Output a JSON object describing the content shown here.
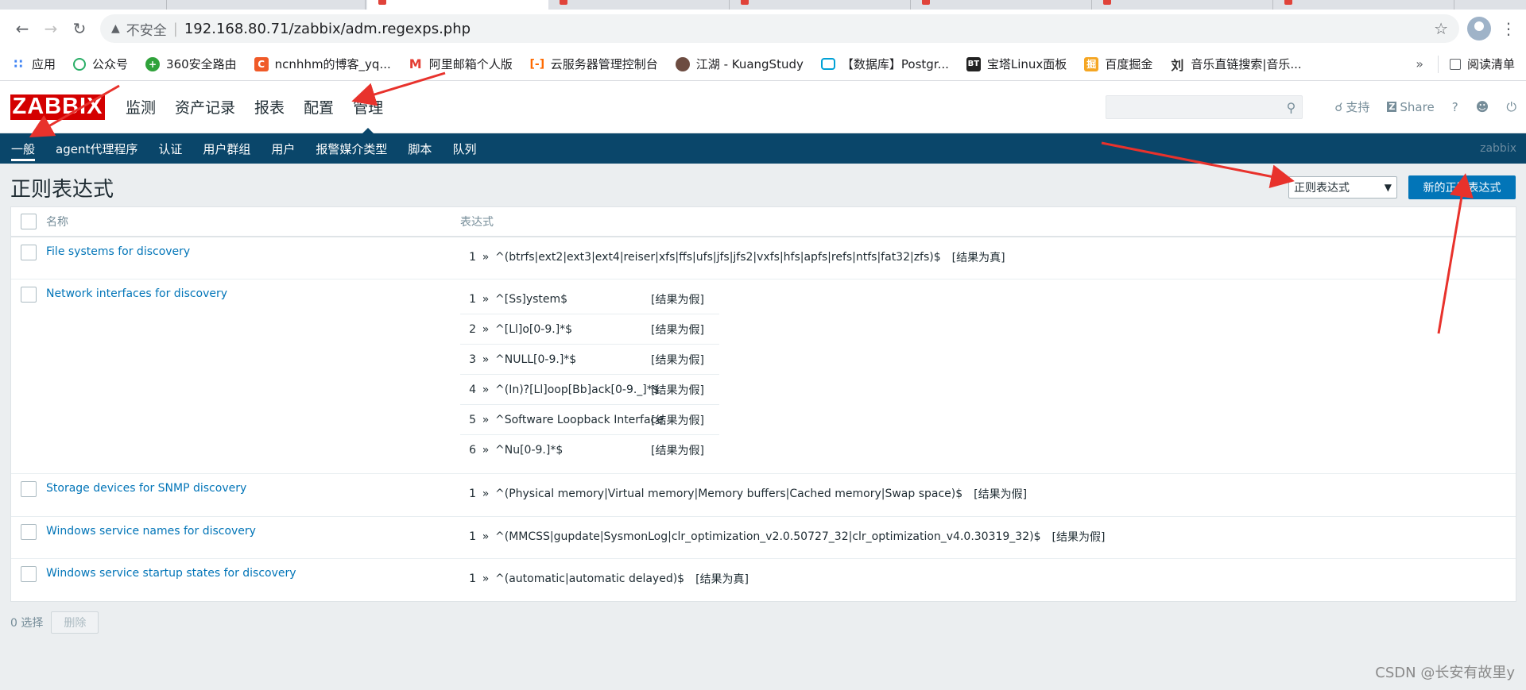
{
  "browser": {
    "insecure_label": "不安全",
    "url": "192.168.80.71/zabbix/adm.regexps.php"
  },
  "bookmarks": [
    {
      "label": "应用",
      "icon": "apps-grid-icon",
      "color": "#4285f4"
    },
    {
      "label": "公众号",
      "icon": "wechat-icon",
      "color": "#2aae67"
    },
    {
      "label": "360安全路由",
      "icon": "360-icon",
      "color": "#2fa23a"
    },
    {
      "label": "ncnhhm的博客_yq...",
      "icon": "csdn-icon",
      "color": "#f05a28"
    },
    {
      "label": "阿里邮箱个人版",
      "icon": "aliyun-mail-icon",
      "color": "#e33e33"
    },
    {
      "label": "云服务器管理控制台",
      "icon": "aliyun-icon",
      "color": "#ff6a00"
    },
    {
      "label": "江湖 - KuangStudy",
      "icon": "kuangstudy-icon",
      "color": "#6d4c41"
    },
    {
      "label": "【数据库】Postgr...",
      "icon": "bilibili-icon",
      "color": "#00a1d6"
    },
    {
      "label": "宝塔Linux面板",
      "icon": "bt-icon",
      "color": "#222222"
    },
    {
      "label": "百度掘金",
      "icon": "juejin-icon",
      "color": "#f5a623"
    },
    {
      "label": "音乐直链搜索|音乐...",
      "icon": "music-icon",
      "color": "#333333"
    }
  ],
  "bookmarks_more": "»",
  "reading_list": "阅读清单",
  "zabbix": {
    "logo": "ZABBIX",
    "topnav": [
      "监测",
      "资产记录",
      "报表",
      "配置",
      "管理"
    ],
    "support": "支持",
    "share": "Share",
    "help": "?",
    "subnav": [
      "一般",
      "agent代理程序",
      "认证",
      "用户群组",
      "用户",
      "报警媒介类型",
      "脚本",
      "队列"
    ],
    "user": "zabbix"
  },
  "page": {
    "title": "正则表达式",
    "select_value": "正则表达式",
    "new_button": "新的正则表达式",
    "col_name": "名称",
    "col_expression": "表达式",
    "rows": [
      {
        "name": "File systems for discovery",
        "expressions": [
          {
            "n": "1",
            "expr": "^(btrfs|ext2|ext3|ext4|reiser|xfs|ffs|ufs|jfs|jfs2|vxfs|hfs|apfs|refs|ntfs|fat32|zfs)$",
            "result": "[结果为真]"
          }
        ]
      },
      {
        "name": "Network interfaces for discovery",
        "expressions": [
          {
            "n": "1",
            "expr": "^[Ss]ystem$",
            "result": "[结果为假]"
          },
          {
            "n": "2",
            "expr": "^[Ll]o[0-9.]*$",
            "result": "[结果为假]"
          },
          {
            "n": "3",
            "expr": "^NULL[0-9.]*$",
            "result": "[结果为假]"
          },
          {
            "n": "4",
            "expr": "^(In)?[Ll]oop[Bb]ack[0-9._]*$",
            "result": "[结果为假]"
          },
          {
            "n": "5",
            "expr": "^Software Loopback Interface",
            "result": "[结果为假]"
          },
          {
            "n": "6",
            "expr": "^Nu[0-9.]*$",
            "result": "[结果为假]"
          }
        ]
      },
      {
        "name": "Storage devices for SNMP discovery",
        "expressions": [
          {
            "n": "1",
            "expr": "^(Physical memory|Virtual memory|Memory buffers|Cached memory|Swap space)$",
            "result": "[结果为假]"
          }
        ]
      },
      {
        "name": "Windows service names for discovery",
        "expressions": [
          {
            "n": "1",
            "expr": "^(MMCSS|gupdate|SysmonLog|clr_optimization_v2.0.50727_32|clr_optimization_v4.0.30319_32)$",
            "result": "[结果为假]"
          }
        ]
      },
      {
        "name": "Windows service startup states for discovery",
        "expressions": [
          {
            "n": "1",
            "expr": "^(automatic|automatic delayed)$",
            "result": "[结果为真]"
          }
        ]
      }
    ],
    "expr_arrow": "»",
    "selected_count": "0 选择",
    "delete_button": "删除"
  },
  "watermark": "CSDN @长安有故里y",
  "colors": {
    "zabbix_red": "#d40000",
    "nav_blue": "#0a466a",
    "button_blue": "#0275b8",
    "annotation_arrow": "#e8322c"
  }
}
